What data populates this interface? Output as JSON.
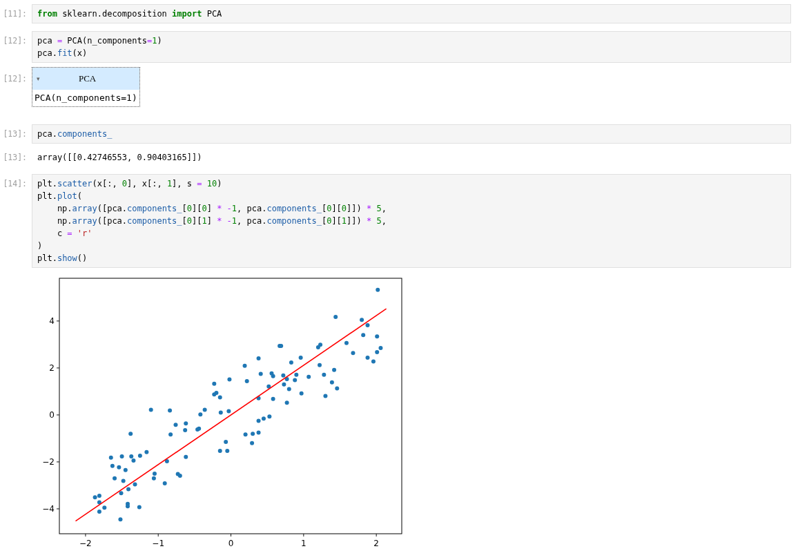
{
  "cells": [
    {
      "kind": "input",
      "prompt": "[11]:",
      "lines": [
        [
          {
            "text": "from",
            "kind": "kw"
          },
          {
            "text": " sklearn.decomposition ",
            "kind": "plain"
          },
          {
            "text": "import",
            "kind": "kw"
          },
          {
            "text": " PCA",
            "kind": "plain"
          }
        ]
      ]
    },
    {
      "kind": "input",
      "prompt": "[12]:",
      "lines": [
        [
          {
            "text": "pca ",
            "kind": "plain"
          },
          {
            "text": "=",
            "kind": "op"
          },
          {
            "text": " PCA(n_components",
            "kind": "plain"
          },
          {
            "text": "=",
            "kind": "op"
          },
          {
            "text": "1",
            "kind": "num"
          },
          {
            "text": ")",
            "kind": "plain"
          }
        ],
        [
          {
            "text": "pca.",
            "kind": "plain"
          },
          {
            "text": "fit",
            "kind": "attr"
          },
          {
            "text": "(x)",
            "kind": "plain"
          }
        ]
      ]
    },
    {
      "kind": "estimator",
      "prompt": "[12]:",
      "expanded": true,
      "toggle": "▾",
      "title": "PCA",
      "body": "PCA(n_components=1)"
    },
    {
      "kind": "input",
      "prompt": "[13]:",
      "lines": [
        [
          {
            "text": "pca.",
            "kind": "plain"
          },
          {
            "text": "components_",
            "kind": "attr"
          }
        ]
      ]
    },
    {
      "kind": "text",
      "prompt": "[13]:",
      "text": "array([[0.42746553, 0.90403165]])"
    },
    {
      "kind": "input",
      "prompt": "[14]:",
      "lines": [
        [
          {
            "text": "plt.",
            "kind": "plain"
          },
          {
            "text": "scatter",
            "kind": "attr"
          },
          {
            "text": "(x[:, ",
            "kind": "plain"
          },
          {
            "text": "0",
            "kind": "num"
          },
          {
            "text": "], x[:, ",
            "kind": "plain"
          },
          {
            "text": "1",
            "kind": "num"
          },
          {
            "text": "], s ",
            "kind": "plain"
          },
          {
            "text": "=",
            "kind": "op"
          },
          {
            "text": " 10",
            "kind": "num"
          },
          {
            "text": ")",
            "kind": "plain"
          }
        ],
        [
          {
            "text": "plt.",
            "kind": "plain"
          },
          {
            "text": "plot",
            "kind": "attr"
          },
          {
            "text": "(",
            "kind": "plain"
          }
        ],
        [
          {
            "text": "    np.",
            "kind": "plain"
          },
          {
            "text": "array",
            "kind": "attr"
          },
          {
            "text": "([pca.",
            "kind": "plain"
          },
          {
            "text": "components_",
            "kind": "attr"
          },
          {
            "text": "[",
            "kind": "plain"
          },
          {
            "text": "0",
            "kind": "num"
          },
          {
            "text": "][",
            "kind": "plain"
          },
          {
            "text": "0",
            "kind": "num"
          },
          {
            "text": "] ",
            "kind": "plain"
          },
          {
            "text": "*",
            "kind": "op"
          },
          {
            "text": " -",
            "kind": "op"
          },
          {
            "text": "1",
            "kind": "num"
          },
          {
            "text": ", pca.",
            "kind": "plain"
          },
          {
            "text": "components_",
            "kind": "attr"
          },
          {
            "text": "[",
            "kind": "plain"
          },
          {
            "text": "0",
            "kind": "num"
          },
          {
            "text": "][",
            "kind": "plain"
          },
          {
            "text": "0",
            "kind": "num"
          },
          {
            "text": "]]) ",
            "kind": "plain"
          },
          {
            "text": "*",
            "kind": "op"
          },
          {
            "text": " 5",
            "kind": "num"
          },
          {
            "text": ",",
            "kind": "plain"
          }
        ],
        [
          {
            "text": "    np.",
            "kind": "plain"
          },
          {
            "text": "array",
            "kind": "attr"
          },
          {
            "text": "([pca.",
            "kind": "plain"
          },
          {
            "text": "components_",
            "kind": "attr"
          },
          {
            "text": "[",
            "kind": "plain"
          },
          {
            "text": "0",
            "kind": "num"
          },
          {
            "text": "][",
            "kind": "plain"
          },
          {
            "text": "1",
            "kind": "num"
          },
          {
            "text": "] ",
            "kind": "plain"
          },
          {
            "text": "*",
            "kind": "op"
          },
          {
            "text": " -",
            "kind": "op"
          },
          {
            "text": "1",
            "kind": "num"
          },
          {
            "text": ", pca.",
            "kind": "plain"
          },
          {
            "text": "components_",
            "kind": "attr"
          },
          {
            "text": "[",
            "kind": "plain"
          },
          {
            "text": "0",
            "kind": "num"
          },
          {
            "text": "][",
            "kind": "plain"
          },
          {
            "text": "1",
            "kind": "num"
          },
          {
            "text": "]]) ",
            "kind": "plain"
          },
          {
            "text": "*",
            "kind": "op"
          },
          {
            "text": " 5",
            "kind": "num"
          },
          {
            "text": ",",
            "kind": "plain"
          }
        ],
        [
          {
            "text": "    c ",
            "kind": "plain"
          },
          {
            "text": "= ",
            "kind": "op"
          },
          {
            "text": "'r'",
            "kind": "str"
          }
        ],
        [
          {
            "text": ")",
            "kind": "plain"
          }
        ],
        [
          {
            "text": "plt.",
            "kind": "plain"
          },
          {
            "text": "show",
            "kind": "attr"
          },
          {
            "text": "()",
            "kind": "plain"
          }
        ]
      ]
    },
    {
      "kind": "plot",
      "chart_data": {
        "type": "scatter",
        "xlim": [
          -2.36,
          2.35
        ],
        "ylim": [
          -5.06,
          5.82
        ],
        "xticks": [
          {
            "value": -2,
            "label": "−2"
          },
          {
            "value": -1,
            "label": "−1"
          },
          {
            "value": 0,
            "label": "0"
          },
          {
            "value": 1,
            "label": "1"
          },
          {
            "value": 2,
            "label": "2"
          }
        ],
        "yticks": [
          {
            "value": -4,
            "label": "−4"
          },
          {
            "value": -2,
            "label": "−2"
          },
          {
            "value": 0,
            "label": "0"
          },
          {
            "value": 2,
            "label": "2"
          },
          {
            "value": 4,
            "label": "4"
          }
        ],
        "series": [
          {
            "color": "#1f77b4",
            "x": [
              2.02,
              1.44,
              1.8,
              1.88,
              1.82,
              2.01,
              1.59,
              1.68,
              2.06,
              2.01,
              1.88,
              1.96,
              0.67,
              0.69,
              1.2,
              1.23,
              0.96,
              0.83,
              0.38,
              0.19,
              1.22,
              1.42,
              0.41,
              0.56,
              0.58,
              0.72,
              0.9,
              1.28,
              1.07,
              0.77,
              0.88,
              0.22,
              -0.02,
              -0.23,
              0.73,
              1.39,
              0.52,
              0.8,
              1.46,
              -0.2,
              -0.23,
              0.97,
              -0.15,
              0.38,
              0.58,
              1.3,
              0.77,
              -1.1,
              -0.84,
              -0.36,
              -0.14,
              -0.03,
              -0.42,
              0.53,
              0.45,
              0.38,
              -0.76,
              -0.62,
              -0.83,
              -0.63,
              -0.46,
              -0.44,
              -1.38,
              0.2,
              0.3,
              0.38,
              0.29,
              -0.07,
              -0.15,
              -0.05,
              -1.16,
              -1.25,
              -1.65,
              -1.5,
              -1.37,
              -1.34,
              -0.62,
              -0.88,
              -1.63,
              -1.54,
              -1.45,
              -1.05,
              -0.73,
              -0.7,
              -1.6,
              -1.06,
              -1.48,
              -0.91,
              -1.32,
              -1.51,
              -1.41,
              -1.87,
              -1.81,
              -1.81,
              -1.74,
              -1.42,
              -1.42,
              -1.26,
              -1.81,
              -1.52
            ],
            "values": [
              5.33,
              4.17,
              4.05,
              3.82,
              3.4,
              3.34,
              3.06,
              2.64,
              2.85,
              2.67,
              2.44,
              2.28,
              2.94,
              2.94,
              2.88,
              2.99,
              2.44,
              2.23,
              2.41,
              2.09,
              2.12,
              1.92,
              1.75,
              1.77,
              1.65,
              1.68,
              1.71,
              1.71,
              1.62,
              1.53,
              1.48,
              1.44,
              1.51,
              1.33,
              1.3,
              1.39,
              1.21,
              1.1,
              1.13,
              0.94,
              0.87,
              0.92,
              0.75,
              0.71,
              0.68,
              0.81,
              0.52,
              0.22,
              0.19,
              0.22,
              0.1,
              0.16,
              0.02,
              -0.07,
              -0.16,
              -0.25,
              -0.42,
              -0.36,
              -0.83,
              -0.65,
              -0.62,
              -0.58,
              -0.8,
              -0.83,
              -0.8,
              -0.75,
              -1.2,
              -1.15,
              -1.53,
              -1.53,
              -1.58,
              -1.74,
              -1.82,
              -1.77,
              -1.77,
              -1.94,
              -1.79,
              -1.97,
              -2.17,
              -2.23,
              -2.35,
              -2.5,
              -2.52,
              -2.59,
              -2.7,
              -2.7,
              -2.81,
              -2.91,
              -2.96,
              -3.33,
              -3.16,
              -3.51,
              -3.44,
              -3.72,
              -3.95,
              -3.79,
              -3.89,
              -3.93,
              -4.12,
              -4.45
            ]
          },
          {
            "type": "line",
            "color": "#ff0000",
            "x": [
              -2.137,
              2.137
            ],
            "values": [
              -4.52,
              4.52
            ]
          }
        ]
      }
    }
  ]
}
